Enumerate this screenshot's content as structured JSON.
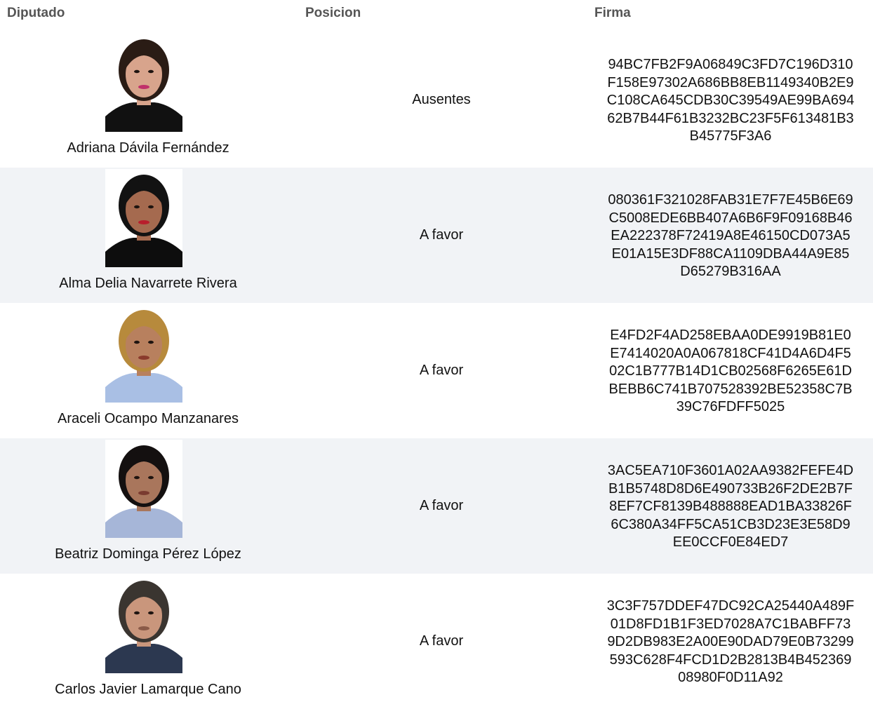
{
  "table": {
    "headers": {
      "diputado": "Diputado",
      "posicion": "Posicion",
      "firma": "Firma"
    },
    "rows": [
      {
        "name": "Adriana Dávila Fernández",
        "position": "Ausentes",
        "signature": "94BC7FB2F9A06849C3FD7C196D310\nF158E97302A686BB8EB1149340B2E9\nC108CA645CDB30C39549AE99BA694\n62B7B44F61B3232BC23F5F613481B3\nB45775F3A6",
        "photo": {
          "bg": "#ffffff",
          "hair": "#2a1c15",
          "skin": "#d8a48c",
          "shirt": "#111111",
          "lips": "#c0306a"
        }
      },
      {
        "name": "Alma Delia Navarrete Rivera",
        "position": "A favor",
        "signature": "080361F321028FAB31E7F7E45B6E69\nC5008EDE6BB407A6B6F9F09168B46\nEA222378F72419A8E46150CD073A5\nE01A15E3DF88CA1109DBA44A9E85\nD65279B316AA",
        "photo": {
          "bg": "#ffffff",
          "hair": "#121212",
          "skin": "#a56a4f",
          "shirt": "#0d0d0d",
          "lips": "#b81e2c"
        }
      },
      {
        "name": "Araceli Ocampo Manzanares",
        "position": "A favor",
        "signature": "E4FD2F4AD258EBAA0DE9919B81E0\nE7414020A0A067818CF41D4A6D4F5\n02C1B777B14D1CB02568F6265E61D\nBEBB6C741B707528392BE52358C7B\n39C76FDFF5025",
        "photo": {
          "bg": "#ffffff",
          "hair": "#b78a3c",
          "skin": "#b8805e",
          "shirt": "#a9bfe4",
          "lips": "#8a3a2c"
        }
      },
      {
        "name": "Beatriz Dominga Pérez López",
        "position": "A favor",
        "signature": "3AC5EA710F3601A02AA9382FEFE4D\nB1B5748D8D6E490733B26F2DE2B7F\n8EF7CF8139B488888EAD1BA33826F\n6C380A34FF5CA51CB3D23E3E58D9\nEE0CCF0E84ED7",
        "photo": {
          "bg": "#ffffff",
          "hair": "#141010",
          "skin": "#a9765c",
          "shirt": "#a6b6d8",
          "lips": "#7a3b30"
        }
      },
      {
        "name": "Carlos Javier Lamarque Cano",
        "position": "A favor",
        "signature": "3C3F757DDEF47DC92CA25440A489F\n01D8FD1B1F3ED7028A7C1BABFF73\n9D2DB983E2A00E90DAD79E0B73299\n593C628F4FCD1D2B2813B4B452369\n08980F0D11A92",
        "photo": {
          "bg": "#ffffff",
          "hair": "#3a3530",
          "skin": "#c9967c",
          "shirt": "#2c3850",
          "lips": "#8a5a48"
        }
      }
    ]
  }
}
